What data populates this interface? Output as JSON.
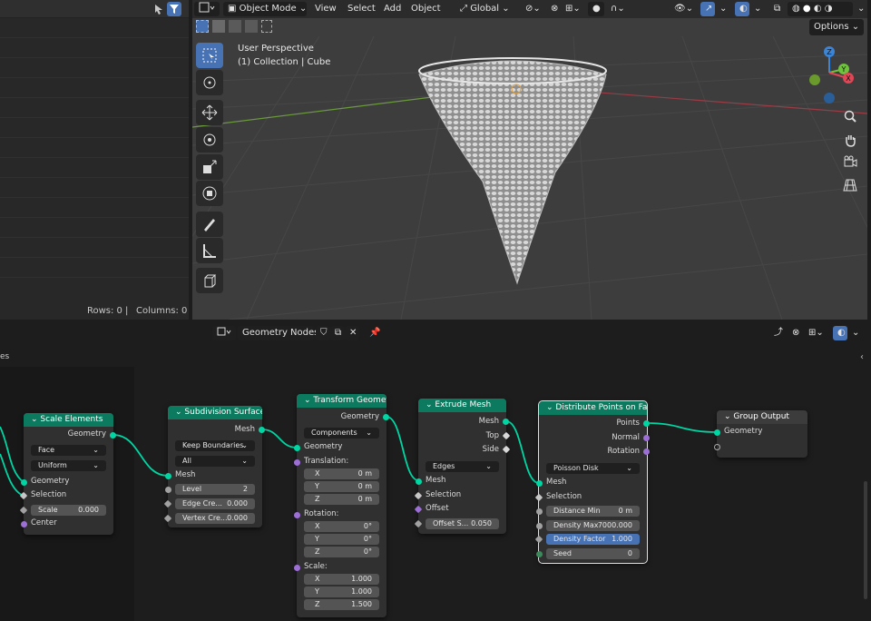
{
  "spreadsheet": {
    "rows_label": "Rows: 0",
    "columns_label": "Columns: 0",
    "separator": "|"
  },
  "viewport": {
    "mode": "Object Mode",
    "menus": [
      "View",
      "Select",
      "Add",
      "Object"
    ],
    "transform_orientation": "Global",
    "options_label": "Options",
    "perspective_label": "User Perspective",
    "collection_label": "(1) Collection | Cube",
    "gizmo_axes": {
      "z": "Z",
      "y": "Y",
      "x": "X"
    }
  },
  "node_editor": {
    "tree_type": "Geometry Nodes",
    "left_label": "es"
  },
  "nodes": {
    "scale_elements": {
      "title": "Scale Elements",
      "out_geometry": "Geometry",
      "domain": "Face",
      "scale_mode": "Uniform",
      "in_geometry": "Geometry",
      "selection": "Selection",
      "scale_label": "Scale",
      "scale_value": "0.000",
      "center": "Center"
    },
    "subdivision_surface": {
      "title": "Subdivision Surface",
      "out_mesh": "Mesh",
      "boundary": "Keep Boundaries",
      "uv": "All",
      "in_mesh": "Mesh",
      "level_label": "Level",
      "level_value": "2",
      "edge_crease_label": "Edge Cre...",
      "edge_crease_value": "0.000",
      "vertex_crease_label": "Vertex Cre...",
      "vertex_crease_value": "0.000"
    },
    "transform_geometry": {
      "title": "Transform Geometry",
      "out_geometry": "Geometry",
      "mode": "Components",
      "in_geometry": "Geometry",
      "translation": "Translation:",
      "tx": "0 m",
      "ty": "0 m",
      "tz": "0 m",
      "rotation": "Rotation:",
      "rx": "0°",
      "ry": "0°",
      "rz": "0°",
      "scale": "Scale:",
      "sx": "1.000",
      "sy": "1.000",
      "sz": "1.500",
      "x": "X",
      "y": "Y",
      "z": "Z"
    },
    "extrude_mesh": {
      "title": "Extrude Mesh",
      "out_mesh": "Mesh",
      "out_top": "Top",
      "out_side": "Side",
      "mode": "Edges",
      "in_mesh": "Mesh",
      "selection": "Selection",
      "offset": "Offset",
      "offset_scale_label": "Offset S...",
      "offset_scale_value": "0.050"
    },
    "distribute_points": {
      "title": "Distribute Points on Faces",
      "out_points": "Points",
      "out_normal": "Normal",
      "out_rotation": "Rotation",
      "method": "Poisson Disk",
      "in_mesh": "Mesh",
      "selection": "Selection",
      "distance_min_label": "Distance Min",
      "distance_min_value": "0 m",
      "density_max_label": "Density Max",
      "density_max_value": "7000.000",
      "density_factor_label": "Density Factor",
      "density_factor_value": "1.000",
      "seed_label": "Seed",
      "seed_value": "0"
    },
    "group_output": {
      "title": "Group Output",
      "in_geometry": "Geometry"
    }
  },
  "colors": {
    "geometry_socket": "#00d6a3",
    "vector_socket": "#9c6fd6",
    "float_socket": "#a1a1a1",
    "node_header": "#0c7a5e",
    "accent_blue": "#4772b3"
  }
}
